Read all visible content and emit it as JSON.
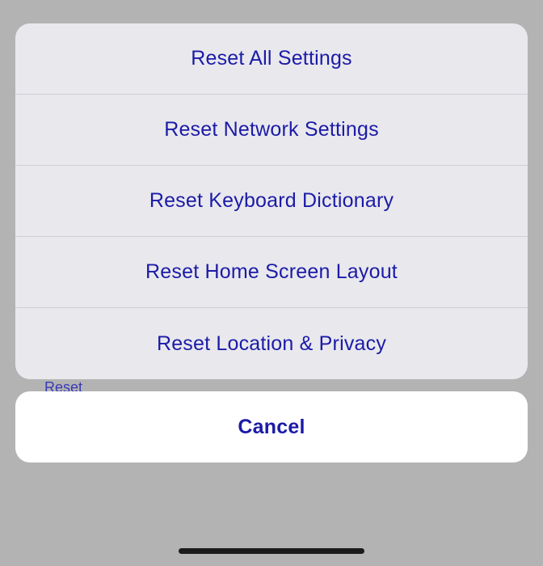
{
  "action_sheet": {
    "options": [
      {
        "label": "Reset All Settings"
      },
      {
        "label": "Reset Network Settings"
      },
      {
        "label": "Reset Keyboard Dictionary"
      },
      {
        "label": "Reset Home Screen Layout"
      },
      {
        "label": "Reset Location & Privacy"
      }
    ],
    "cancel_label": "Cancel"
  },
  "background": {
    "partial_text": "Reset"
  }
}
